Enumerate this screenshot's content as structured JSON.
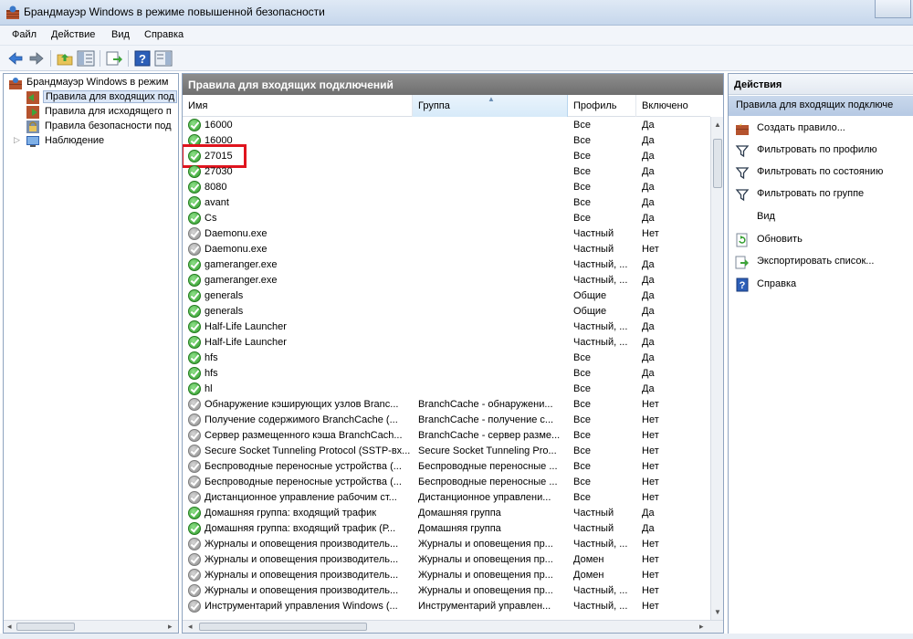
{
  "window": {
    "title": "Брандмауэр Windows в режиме повышенной безопасности"
  },
  "menu": [
    "Файл",
    "Действие",
    "Вид",
    "Справка"
  ],
  "tree": {
    "root": "Брандмауэр Windows в режим",
    "items": [
      {
        "label": "Правила для входящих под",
        "selected": true
      },
      {
        "label": "Правила для исходящего п",
        "selected": false
      },
      {
        "label": "Правила безопасности под",
        "selected": false
      },
      {
        "label": "Наблюдение",
        "selected": false
      }
    ]
  },
  "center": {
    "header": "Правила для входящих подключений",
    "columns": {
      "name": "Имя",
      "group": "Группа",
      "profile": "Профиль",
      "enabled": "Включено"
    },
    "rows": [
      {
        "name": "16000",
        "group": "",
        "profile": "Все",
        "enabled": "Да",
        "on": true
      },
      {
        "name": "16000",
        "group": "",
        "profile": "Все",
        "enabled": "Да",
        "on": true
      },
      {
        "name": "27015",
        "group": "",
        "profile": "Все",
        "enabled": "Да",
        "on": true
      },
      {
        "name": "27030",
        "group": "",
        "profile": "Все",
        "enabled": "Да",
        "on": true
      },
      {
        "name": "8080",
        "group": "",
        "profile": "Все",
        "enabled": "Да",
        "on": true
      },
      {
        "name": "avant",
        "group": "",
        "profile": "Все",
        "enabled": "Да",
        "on": true
      },
      {
        "name": "Cs",
        "group": "",
        "profile": "Все",
        "enabled": "Да",
        "on": true
      },
      {
        "name": "Daemonu.exe",
        "group": "",
        "profile": "Частный",
        "enabled": "Нет",
        "on": false
      },
      {
        "name": "Daemonu.exe",
        "group": "",
        "profile": "Частный",
        "enabled": "Нет",
        "on": false
      },
      {
        "name": "gameranger.exe",
        "group": "",
        "profile": "Частный, ...",
        "enabled": "Да",
        "on": true
      },
      {
        "name": "gameranger.exe",
        "group": "",
        "profile": "Частный, ...",
        "enabled": "Да",
        "on": true
      },
      {
        "name": "generals",
        "group": "",
        "profile": "Общие",
        "enabled": "Да",
        "on": true
      },
      {
        "name": "generals",
        "group": "",
        "profile": "Общие",
        "enabled": "Да",
        "on": true
      },
      {
        "name": "Half-Life Launcher",
        "group": "",
        "profile": "Частный, ...",
        "enabled": "Да",
        "on": true
      },
      {
        "name": "Half-Life Launcher",
        "group": "",
        "profile": "Частный, ...",
        "enabled": "Да",
        "on": true
      },
      {
        "name": "hfs",
        "group": "",
        "profile": "Все",
        "enabled": "Да",
        "on": true
      },
      {
        "name": "hfs",
        "group": "",
        "profile": "Все",
        "enabled": "Да",
        "on": true
      },
      {
        "name": "hl",
        "group": "",
        "profile": "Все",
        "enabled": "Да",
        "on": true
      },
      {
        "name": "Обнаружение кэширующих узлов Branc...",
        "group": "BranchCache - обнаружени...",
        "profile": "Все",
        "enabled": "Нет",
        "on": false
      },
      {
        "name": "Получение содержимого BranchCache (...",
        "group": "BranchCache - получение с...",
        "profile": "Все",
        "enabled": "Нет",
        "on": false
      },
      {
        "name": "Сервер размещенного кэша BranchCach...",
        "group": "BranchCache - сервер разме...",
        "profile": "Все",
        "enabled": "Нет",
        "on": false
      },
      {
        "name": "Secure Socket Tunneling Protocol (SSTP-вх...",
        "group": "Secure Socket Tunneling Pro...",
        "profile": "Все",
        "enabled": "Нет",
        "on": false
      },
      {
        "name": "Беспроводные переносные устройства (...",
        "group": "Беспроводные переносные ...",
        "profile": "Все",
        "enabled": "Нет",
        "on": false
      },
      {
        "name": "Беспроводные переносные устройства (...",
        "group": "Беспроводные переносные ...",
        "profile": "Все",
        "enabled": "Нет",
        "on": false
      },
      {
        "name": "Дистанционное управление рабочим ст...",
        "group": "Дистанционное управлени...",
        "profile": "Все",
        "enabled": "Нет",
        "on": false
      },
      {
        "name": "Домашняя группа: входящий трафик",
        "group": "Домашняя группа",
        "profile": "Частный",
        "enabled": "Да",
        "on": true
      },
      {
        "name": "Домашняя группа: входящий трафик (Р...",
        "group": "Домашняя группа",
        "profile": "Частный",
        "enabled": "Да",
        "on": true
      },
      {
        "name": "Журналы и оповещения производитель...",
        "group": "Журналы и оповещения пр...",
        "profile": "Частный, ...",
        "enabled": "Нет",
        "on": false
      },
      {
        "name": "Журналы и оповещения производитель...",
        "group": "Журналы и оповещения пр...",
        "profile": "Домен",
        "enabled": "Нет",
        "on": false
      },
      {
        "name": "Журналы и оповещения производитель...",
        "group": "Журналы и оповещения пр...",
        "profile": "Домен",
        "enabled": "Нет",
        "on": false
      },
      {
        "name": "Журналы и оповещения производитель...",
        "group": "Журналы и оповещения пр...",
        "profile": "Частный, ...",
        "enabled": "Нет",
        "on": false
      },
      {
        "name": "Инструментарий управления Windows (...",
        "group": "Инструментарий управлен...",
        "profile": "Частный, ...",
        "enabled": "Нет",
        "on": false
      }
    ]
  },
  "actions": {
    "title": "Действия",
    "section": "Правила для входящих подключе",
    "items": [
      {
        "label": "Создать правило...",
        "icon": "new-rule-icon"
      },
      {
        "label": "Фильтровать по профилю",
        "icon": "filter-icon"
      },
      {
        "label": "Фильтровать по состоянию",
        "icon": "filter-icon"
      },
      {
        "label": "Фильтровать по группе",
        "icon": "filter-icon"
      },
      {
        "label": "Вид",
        "icon": ""
      },
      {
        "label": "Обновить",
        "icon": "refresh-icon"
      },
      {
        "label": "Экспортировать список...",
        "icon": "export-icon"
      },
      {
        "label": "Справка",
        "icon": "help-icon"
      }
    ]
  },
  "colors": {
    "accent": "#3a6ea5",
    "highlight": "#e0141e",
    "enabled": "#2f9d2a",
    "disabled": "#8c8c8c"
  }
}
